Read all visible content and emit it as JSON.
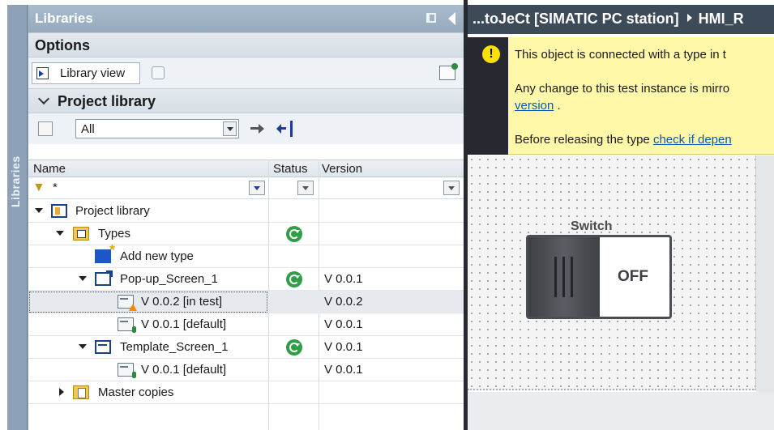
{
  "sidebar_tab": {
    "label": "Libraries"
  },
  "libraries": {
    "title": "Libraries",
    "options": {
      "header": "Options",
      "library_view_label": "Library view"
    },
    "project_library": {
      "header": "Project library",
      "filter_value": "All",
      "columns": {
        "name": "Name",
        "status": "Status",
        "version": "Version"
      },
      "filter_row": {
        "name_filter": "*"
      },
      "tree": [
        {
          "label": "Project library",
          "status": "",
          "version": ""
        },
        {
          "label": "Types",
          "status": "synced",
          "version": ""
        },
        {
          "label": "Add new type",
          "status": "",
          "version": ""
        },
        {
          "label": "Pop-up_Screen_1",
          "status": "synced",
          "version": "V 0.0.1"
        },
        {
          "label": "V 0.0.2 [in test]",
          "status": "",
          "version": "V 0.0.2"
        },
        {
          "label": "V 0.0.1 [default]",
          "status": "",
          "version": "V 0.0.1"
        },
        {
          "label": "Template_Screen_1",
          "status": "synced",
          "version": "V 0.0.1"
        },
        {
          "label": "V 0.0.1 [default]",
          "status": "",
          "version": "V 0.0.1"
        },
        {
          "label": "Master copies",
          "status": "",
          "version": ""
        }
      ]
    }
  },
  "editor": {
    "breadcrumb": [
      "...toJeCt [SIMATIC PC station]",
      "HMI_R"
    ],
    "warning": {
      "icon": "warning-icon",
      "line1": "This object is connected with a type in t",
      "line2": "Any change to this test instance is mirro",
      "link_version": "version",
      "line2_end": " .",
      "line3_prefix": "Before releasing the type ",
      "link_check": "check if depen"
    },
    "switch": {
      "label": "Switch",
      "state": "OFF"
    }
  },
  "colors": {
    "title_bar": "#95aabd",
    "editor_title": "#3d4a58",
    "warning_bg": "#fff8a8",
    "sync_green": "#2f9e46",
    "link_blue": "#0a57b5"
  }
}
